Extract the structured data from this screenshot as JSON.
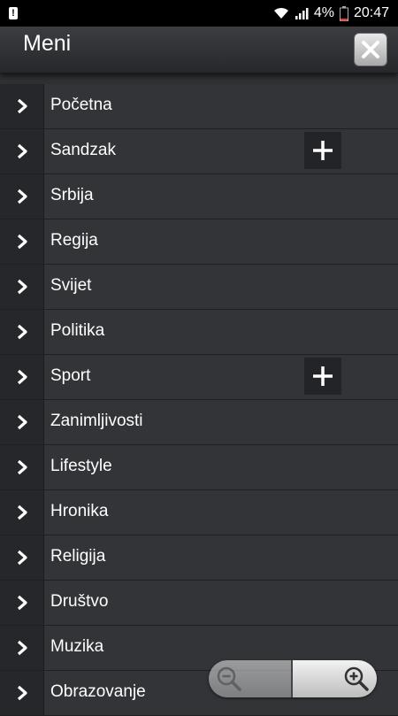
{
  "status_bar": {
    "battery_percent": "4%",
    "time": "20:47"
  },
  "header": {
    "title": "Meni"
  },
  "menu": {
    "items": [
      {
        "label": "Početna",
        "expandable": false
      },
      {
        "label": "Sandzak",
        "expandable": true
      },
      {
        "label": "Srbija",
        "expandable": false
      },
      {
        "label": "Regija",
        "expandable": false
      },
      {
        "label": "Svijet",
        "expandable": false
      },
      {
        "label": "Politika",
        "expandable": false
      },
      {
        "label": "Sport",
        "expandable": true
      },
      {
        "label": "Zanimljivosti",
        "expandable": false
      },
      {
        "label": "Lifestyle",
        "expandable": false
      },
      {
        "label": "Hronika",
        "expandable": false
      },
      {
        "label": "Religija",
        "expandable": false
      },
      {
        "label": "Društvo",
        "expandable": false
      },
      {
        "label": "Muzika",
        "expandable": false
      },
      {
        "label": "Obrazovanje",
        "expandable": false
      }
    ]
  },
  "icons": {
    "close": "close-icon",
    "chevron": "chevron-right-icon",
    "plus": "plus-icon",
    "zoom_out": "zoom-out-icon",
    "zoom_in": "zoom-in-icon"
  },
  "colors": {
    "background": "#2f3134",
    "header": "#2c2e31",
    "text": "#ffffff"
  }
}
